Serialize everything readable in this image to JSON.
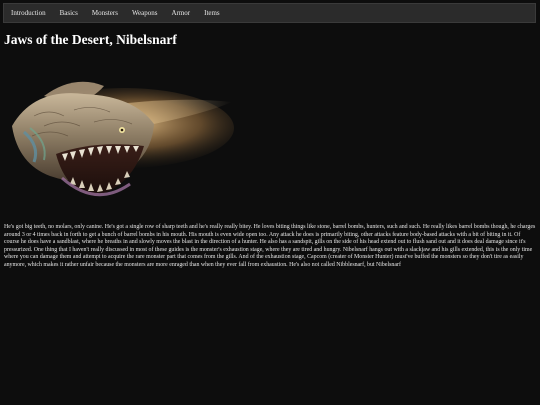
{
  "nav": {
    "items": [
      {
        "label": "Introduction"
      },
      {
        "label": "Basics"
      },
      {
        "label": "Monsters"
      },
      {
        "label": "Weapons"
      },
      {
        "label": "Armor"
      },
      {
        "label": "Items"
      }
    ]
  },
  "page": {
    "title": "Jaws of the Desert, Nibelsnarf",
    "image_name": "nibelsnarf-monster-image",
    "description": "He's got big teeth, no molars, only canine. He's got a single row of sharp teeth and he's really really bitey. He loves biting things like stone, barrel bombs, hunters, such and such. He really likes barrel bombs though, he charges around 3 or 4 times back in forth to get a bunch of barrel bombs in his mouth. His mouth is even wide open too. Any attack he does is primarily biting, other attacks feature body-based attacks with a bit of biting in it. Of course he does have a sandblast, where he breaths in and slowly moves the blast in the direction of a hunter. He also has a sandspit, gills on the side of his head extend out to flush sand out and it does deal damage since it's pressurized. One thing that I haven't really discussed in most of these guides is the monster's exhaustion stage, where they are tired and hungry. Nibelsnarf hangs out with a slackjaw and his gills extended, this is the only time where you can damage them and attempt to acquire the rare monster part that comes from the gills. And of the exhaustion stage, Capcom (creater of Monster Hunter) must've buffed the monsters so they don't tire as easily anymore, which makes it rather unfair because the monsters are more enraged than when they ever fall from exhaustion. He's also not called Nibblesnarf, but Nibelsnarf"
  },
  "colors": {
    "background": "#0d0d0d",
    "navbar": "#2b2b2b",
    "text": "#ffffff"
  }
}
